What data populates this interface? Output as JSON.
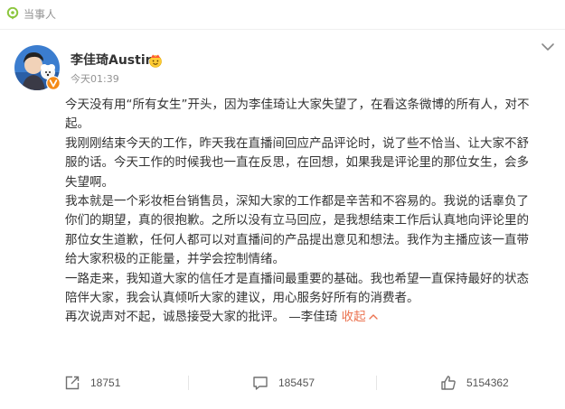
{
  "topbar": {
    "label": "当事人"
  },
  "post": {
    "author": "李佳琦Austin",
    "time": "今天01:39",
    "lines": [
      "今天没有用“所有女生”开头，因为李佳琦让大家失望了，在看这条微博的所有人，对不",
      "起。",
      "我刚刚结束今天的工作，昨天我在直播间回应产品评论时，说了些不恰当、让大家不舒",
      "服的话。今天工作的时候我也一直在反思，在回想，如果我是评论里的那位女生，会多",
      "失望啊。",
      "我本就是一个彩妆柜台销售员，深知大家的工作都是辛苦和不容易的。我说的话辜负了",
      "你们的期望，真的很抱歉。之所以没有立马回应，是我想结束工作后认真地向评论里的",
      "那位女生道歉，任何人都可以对直播间的产品提出意见和想法。我作为主播应该一直带",
      "给大家积极的正能量，并学会控制情绪。",
      "一路走来，我知道大家的信任才是直播间最重要的基础。我也希望一直保持最好的状态",
      "陪伴大家，我会认真倾听大家的建议，用心服务好所有的消费者。"
    ],
    "last_line": "再次说声对不起，诚恳接受大家的批评。 —李佳琦",
    "collapse_label": "收起"
  },
  "actions": {
    "repost_count": "18751",
    "comment_count": "185457",
    "like_count": "5154362"
  },
  "colors": {
    "accent": "#eb7350",
    "muted": "#939393",
    "text": "#333333",
    "pin_green": "#8cc63e"
  },
  "icons": [
    "location-pin-icon",
    "chevron-down-icon",
    "verified-badge-icon",
    "crown-emoji-icon",
    "repost-icon",
    "comment-icon",
    "like-icon",
    "caret-up-icon"
  ]
}
